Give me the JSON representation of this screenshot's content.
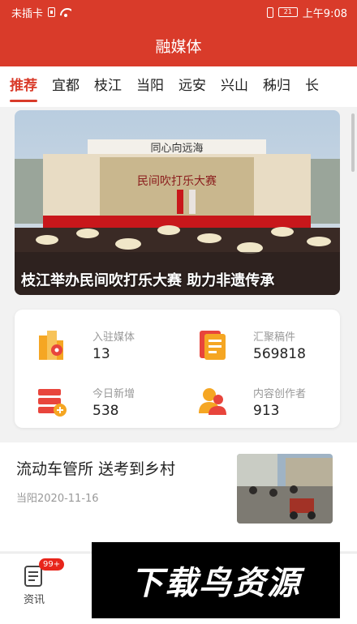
{
  "status_bar": {
    "carrier": "未插卡",
    "battery": "21",
    "time": "上午9:08"
  },
  "header": {
    "title": "融媒体"
  },
  "tabs": [
    {
      "label": "推荐",
      "active": true
    },
    {
      "label": "宜都"
    },
    {
      "label": "枝江"
    },
    {
      "label": "当阳"
    },
    {
      "label": "远安"
    },
    {
      "label": "兴山"
    },
    {
      "label": "秭归"
    },
    {
      "label": "长"
    }
  ],
  "banner": {
    "caption": "枝江举办民间吹打乐大赛 助力非遗传承",
    "stage_top_sign": "同心向远海",
    "stage_title": "民间吹打乐大赛"
  },
  "stats": [
    {
      "label": "入驻媒体",
      "value": "13",
      "icon": "building-location-icon"
    },
    {
      "label": "汇聚稿件",
      "value": "569818",
      "icon": "document-list-icon"
    },
    {
      "label": "今日新增",
      "value": "538",
      "icon": "server-add-icon"
    },
    {
      "label": "内容创作者",
      "value": "913",
      "icon": "users-icon"
    }
  ],
  "news": [
    {
      "title": "流动车管所 送考到乡村",
      "meta": "当阳2020-11-16"
    }
  ],
  "bottom_nav": {
    "news_label": "资讯",
    "badge": "99+"
  },
  "watermark": "下载鸟资源",
  "colors": {
    "brand": "#d93b2a",
    "accent_orange": "#f5a623"
  }
}
